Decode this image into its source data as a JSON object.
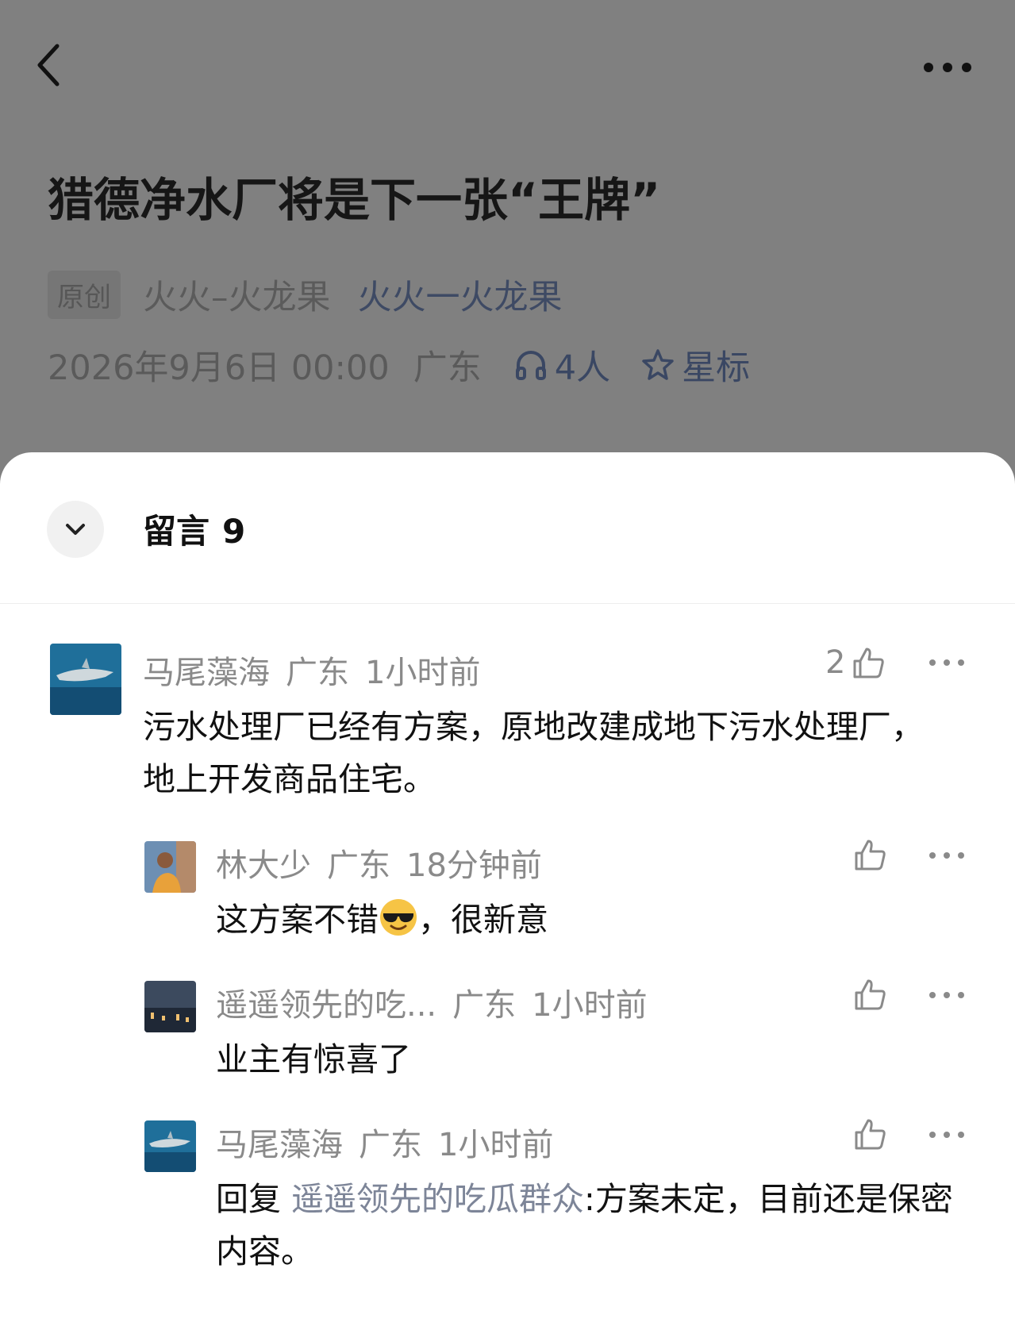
{
  "article": {
    "title": "猎德净水厂将是下一张“王牌”",
    "original_tag": "原创",
    "author": "火火–火龙果",
    "account": "火火一火龙果",
    "datetime": "2026年9月6日 00:00",
    "location": "广东",
    "listeners": "4人",
    "star_label": "星标"
  },
  "comments_panel": {
    "title": "留言",
    "count": "9",
    "comments": [
      {
        "user": "马尾藻海",
        "location": "广东",
        "time": "1小时前",
        "likes": "2",
        "text": "污水处理厂已经有方案，原地改建成地下污水处理厂，地上开发商品住宅。"
      }
    ],
    "replies": [
      {
        "user": "林大少",
        "location": "广东",
        "time": "18分钟前",
        "text_before": "这方案不错",
        "text_after": "，很新意"
      },
      {
        "user": "遥遥领先的吃...",
        "location": "广东",
        "time": "1小时前",
        "text": "业主有惊喜了"
      },
      {
        "user": "马尾藻海",
        "location": "广东",
        "time": "1小时前",
        "reply_prefix": "回复",
        "reply_to": "遥遥领先的吃瓜群众",
        "text": ":方案未定，目前还是保密内容。"
      }
    ]
  },
  "colors": {
    "overlay_bg": "#808080",
    "sheet_bg": "#ffffff",
    "link_blue": "#3a4763"
  }
}
